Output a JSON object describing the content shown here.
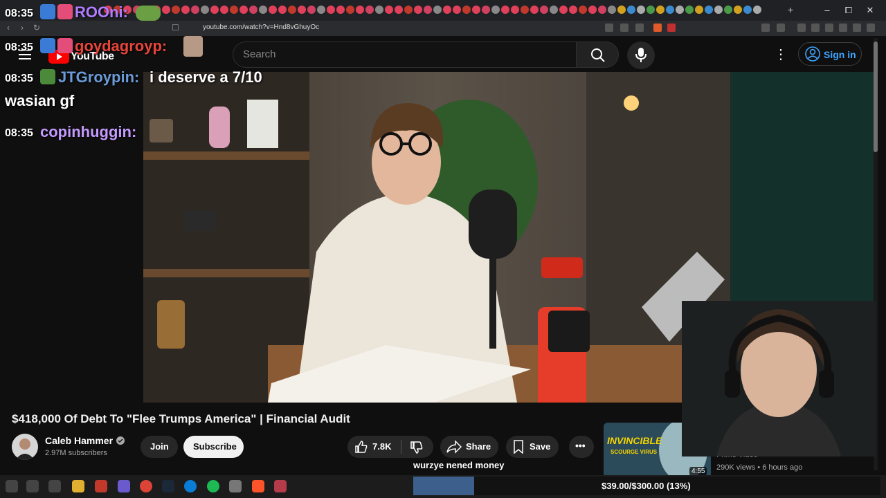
{
  "browser": {
    "url": "youtube.com/watch?v=Hnd8vGhuyOc",
    "window_controls": {
      "minimize": "–",
      "maximize": "⧠",
      "close": "✕"
    },
    "new_tab": "+"
  },
  "youtube": {
    "logo_text": "YouTube",
    "search_placeholder": "Search",
    "sign_in": "Sign in",
    "kebab": "⋮"
  },
  "chat": [
    {
      "time": "08:35",
      "user": "ROOni:",
      "user_color": "#b07dff",
      "message": ""
    },
    {
      "time": "08:35",
      "user": "goydagroyp:",
      "user_color": "#e8443a",
      "message": ""
    },
    {
      "time": "08:35",
      "user": "JTGroypin:",
      "user_color": "#6b9bd8",
      "message": "i deserve a 7/10"
    },
    {
      "time": "",
      "user": "",
      "user_color": "#ffffff",
      "message": "wasian gf"
    },
    {
      "time": "08:35",
      "user": "copinhuggin:",
      "user_color": "#c59bff",
      "message": ""
    }
  ],
  "video": {
    "title": "$418,000 Of Debt To \"Flee Trumps America\" | Financial Audit",
    "channel_name": "Caleb Hammer",
    "verified_icon": "verified-check-icon",
    "subscribers": "2.97M subscribers",
    "join": "Join",
    "subscribe": "Subscribe",
    "likes": "7.8K",
    "share": "Share",
    "save": "Save",
    "more": "•••"
  },
  "recommendation": {
    "thumb_text": "INVINCIBLE",
    "thumb_sub": "SCOURGE VIRUS",
    "duration": "4:55",
    "channel": "Prime Video",
    "meta": "290K views • 6 hours ago"
  },
  "donation_goal": {
    "message": "wurzye nened money",
    "text": "$39.00/$300.00 (13%)",
    "fraction": 0.13
  },
  "colors": {
    "accent_blue": "#3ea6ff",
    "goal_fill": "#3c5f8c",
    "youtube_red": "#ff0000"
  }
}
